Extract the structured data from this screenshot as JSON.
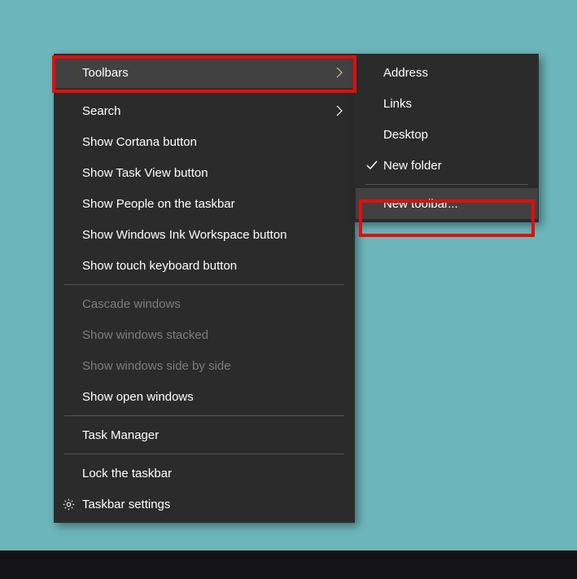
{
  "mainMenu": {
    "toolbars": "Toolbars",
    "search": "Search",
    "showCortana": "Show Cortana button",
    "showTaskView": "Show Task View button",
    "showPeople": "Show People on the taskbar",
    "showInk": "Show Windows Ink Workspace button",
    "showTouchKeyboard": "Show touch keyboard button",
    "cascade": "Cascade windows",
    "stacked": "Show windows stacked",
    "sideBySide": "Show windows side by side",
    "showOpen": "Show open windows",
    "taskManager": "Task Manager",
    "lockTaskbar": "Lock the taskbar",
    "taskbarSettings": "Taskbar settings"
  },
  "subMenu": {
    "address": "Address",
    "links": "Links",
    "desktop": "Desktop",
    "newFolder": "New folder",
    "newToolbar": "New toolbar..."
  }
}
